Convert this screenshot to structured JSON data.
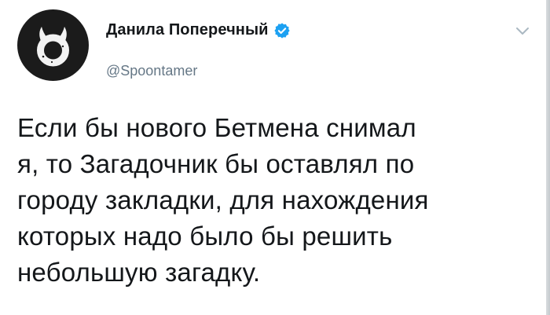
{
  "tweet": {
    "author": {
      "display_name": "Данила Поперечный",
      "handle": "@Spoontamer",
      "verified": true,
      "avatar": "avatar-white-horned-ring-on-black"
    },
    "text": "Если бы нового Бетмена снимал\nя, то Загадочник бы оставлял по\nгороду закладки, для нахождения\nкоторых надо было бы решить\nнебольшую загадку.",
    "menu_icon": "chevron-down-icon"
  },
  "colors": {
    "text": "#14171a",
    "secondary_text": "#657786",
    "verified_badge": "#1da1f2",
    "avatar_bg": "#1b1b1b"
  }
}
